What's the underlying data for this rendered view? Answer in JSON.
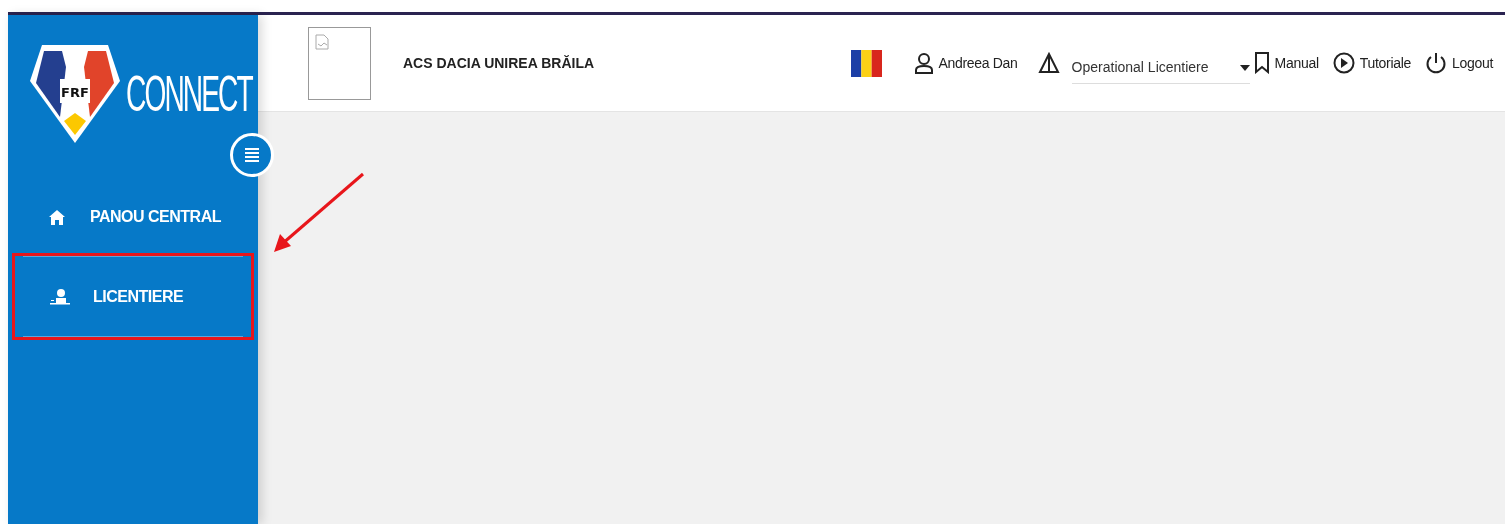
{
  "logo": {
    "badge": "FRF",
    "text": "CONNECT"
  },
  "sidebar": {
    "items": [
      {
        "kind": "home",
        "label": "PANOU CENTRAL",
        "highlighted": false
      },
      {
        "kind": "licensing",
        "label": "LICENTIERE",
        "highlighted": true
      }
    ]
  },
  "header": {
    "club_name": "ACS DACIA UNIREA BRĂILA",
    "user": "Andreea Dan",
    "role_select": {
      "value": "Operational Licentiere"
    },
    "links": [
      {
        "kind": "manual",
        "label": "Manual"
      },
      {
        "kind": "tutorials",
        "label": "Tutoriale"
      },
      {
        "kind": "logout",
        "label": "Logout"
      }
    ]
  }
}
